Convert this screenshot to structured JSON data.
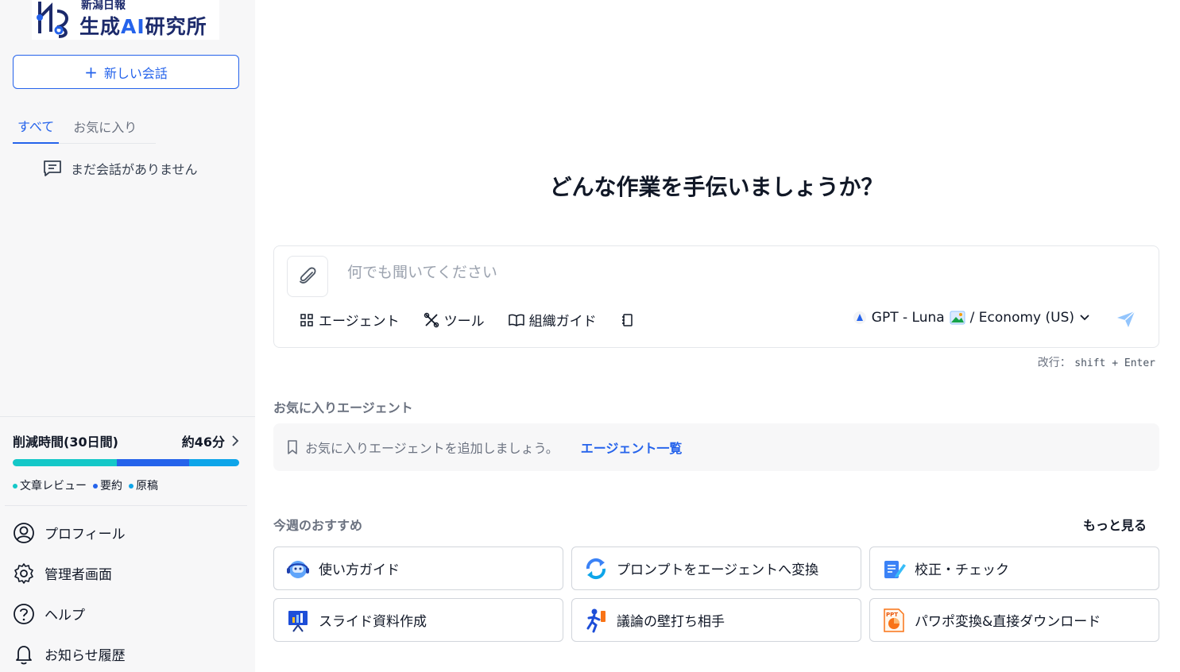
{
  "brand": {
    "sub": "新潟日報",
    "main_pre": "生成",
    "main_ai": "AI",
    "main_post": "研究所"
  },
  "sidebar": {
    "new_chat": "新しい会話",
    "tabs": [
      {
        "label": "すべて"
      },
      {
        "label": "お気に入り"
      }
    ],
    "empty_text": "まだ会話がありません",
    "savings": {
      "title": "削減時間(30日間)",
      "value": "約46分",
      "segments": [
        {
          "label": "文章レビュー",
          "color": "#14c8c8",
          "fraction": 0.46
        },
        {
          "label": "要約",
          "color": "#2563eb",
          "fraction": 0.32
        },
        {
          "label": "原稿",
          "color": "#0ea5e9",
          "fraction": 0.22
        }
      ]
    },
    "menu": [
      {
        "label": "プロフィール",
        "icon": "user-circle-icon"
      },
      {
        "label": "管理者画面",
        "icon": "gear-icon"
      },
      {
        "label": "ヘルプ",
        "icon": "question-circle-icon"
      },
      {
        "label": "お知らせ履歴",
        "icon": "bell-icon"
      }
    ]
  },
  "main": {
    "headline": "どんな作業を手伝いましょうか？",
    "composer": {
      "placeholder": "何でも聞いてください",
      "tools": [
        {
          "label": "エージェント"
        },
        {
          "label": "ツール"
        },
        {
          "label": "組織ガイド"
        }
      ],
      "model": "GPT - Luna",
      "model_suffix": " / Economy (US)"
    },
    "hint_label": "改行：",
    "hint_keys": "shift + Enter",
    "favorites": {
      "title": "お気に入りエージェント",
      "empty": "お気に入りエージェントを追加しましょう。",
      "link": "エージェント一覧"
    },
    "recommend": {
      "title": "今週のおすすめ",
      "more": "もっと見る",
      "cards": [
        {
          "label": "使い方ガイド",
          "icon": "robot-headset-icon"
        },
        {
          "label": "プロンプトをエージェントへ変換",
          "icon": "refresh-arrows-icon"
        },
        {
          "label": "校正・チェック",
          "icon": "document-pen-icon"
        },
        {
          "label": "スライド資料作成",
          "icon": "presentation-chart-icon"
        },
        {
          "label": "議論の壁打ち相手",
          "icon": "running-person-icon"
        },
        {
          "label": "パワポ変換&直接ダウンロード",
          "icon": "ppt-file-icon"
        }
      ]
    }
  }
}
